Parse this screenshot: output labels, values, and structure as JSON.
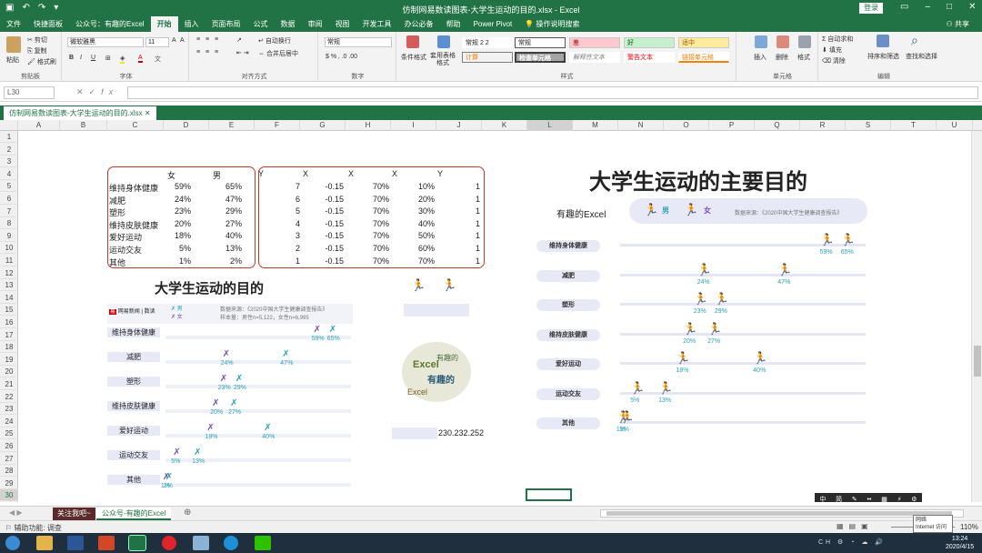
{
  "titlebar": {
    "title": "仿制网易数读图表-大学生运动的目的.xlsx  -  Excel",
    "login": "登录"
  },
  "menu": {
    "tabs": [
      "文件",
      "快捷面板",
      "公众号：有趣的Excel",
      "开始",
      "插入",
      "页面布局",
      "公式",
      "数据",
      "审阅",
      "视图",
      "开发工具",
      "办公必备",
      "帮助",
      "Power Pivot",
      "操作说明搜索"
    ],
    "active": "开始",
    "share": "共享"
  },
  "ribbon": {
    "clipboard": {
      "label": "剪贴板",
      "paste": "粘贴",
      "cut": "剪切",
      "copy": "复制",
      "painter": "格式刷"
    },
    "font": {
      "label": "字体",
      "name": "微软雅黑",
      "size": "11",
      "buttons": [
        "B",
        "I",
        "U"
      ]
    },
    "align": {
      "label": "对齐方式",
      "wrap": "自动换行",
      "merge": "合并后居中"
    },
    "number": {
      "label": "数字",
      "format": "常规"
    },
    "styles": {
      "label": "样式",
      "cond": "条件格式",
      "table": "套用表格格式",
      "s1": "常规 2 2",
      "s2": "常规",
      "s3": "差",
      "s4": "好",
      "s5": "适中",
      "s6": "计算",
      "s7": "检查单元格",
      "s8": "解释性文本",
      "s9": "警告文本",
      "s10": "链接单元格"
    },
    "cells": {
      "label": "单元格",
      "insert": "插入",
      "delete": "删除",
      "format": "格式"
    },
    "edit": {
      "label": "编辑",
      "autosum": "自动求和",
      "fill": "填充",
      "clear": "清除",
      "sort": "排序和筛选",
      "find": "查找和选择"
    }
  },
  "formula": {
    "cell": "L30",
    "fx": "fx"
  },
  "workbook_tab": "仿制网易数读图表-大学生运动的目的.xlsx",
  "columns": [
    "A",
    "B",
    "C",
    "D",
    "E",
    "F",
    "G",
    "H",
    "I",
    "J",
    "K",
    "L",
    "M",
    "N",
    "O",
    "P",
    "Q",
    "R",
    "S",
    "T",
    "U"
  ],
  "rows": [
    "1",
    "2",
    "3",
    "4",
    "5",
    "6",
    "7",
    "8",
    "9",
    "10",
    "11",
    "12",
    "13",
    "14",
    "15",
    "16",
    "17",
    "18",
    "19",
    "20",
    "21",
    "22",
    "23",
    "24",
    "25",
    "26",
    "27",
    "28",
    "29",
    "30"
  ],
  "table1": {
    "headers": [
      "女",
      "男"
    ],
    "rows": [
      [
        "维持身体健康",
        "59%",
        "65%"
      ],
      [
        "减肥",
        "24%",
        "47%"
      ],
      [
        "塑形",
        "23%",
        "29%"
      ],
      [
        "维持皮肤健康",
        "20%",
        "27%"
      ],
      [
        "爱好运动",
        "18%",
        "40%"
      ],
      [
        "运动交友",
        "5%",
        "13%"
      ],
      [
        "其他",
        "1%",
        "2%"
      ]
    ]
  },
  "table2": {
    "headers": [
      "Y",
      "X",
      "X",
      "X",
      "Y"
    ],
    "rows": [
      [
        "7",
        "-0.15",
        "70%",
        "10%",
        "1"
      ],
      [
        "6",
        "-0.15",
        "70%",
        "20%",
        "1"
      ],
      [
        "5",
        "-0.15",
        "70%",
        "30%",
        "1"
      ],
      [
        "4",
        "-0.15",
        "70%",
        "40%",
        "1"
      ],
      [
        "3",
        "-0.15",
        "70%",
        "50%",
        "1"
      ],
      [
        "2",
        "-0.15",
        "70%",
        "60%",
        "1"
      ],
      [
        "1",
        "-0.15",
        "70%",
        "70%",
        "1"
      ]
    ]
  },
  "left_chart": {
    "title": "大学生运动的目的",
    "brand": "网易新闻 | 数读",
    "legend_male": "男",
    "legend_female": "女",
    "source": "数据来源：《2020中国大学生健康调查报告》",
    "sample": "样本量：男性n=5,122，女性n=6,995",
    "categories": [
      "维持身体健康",
      "减肥",
      "塑形",
      "维持皮肤健康",
      "爱好运动",
      "运动交友",
      "其他"
    ],
    "female": [
      59,
      24,
      23,
      20,
      18,
      5,
      1
    ],
    "male": [
      65,
      47,
      29,
      27,
      40,
      13,
      2
    ],
    "female_labels": [
      "59%",
      "24%",
      "23%",
      "20%",
      "18%",
      "5%",
      "1%"
    ],
    "male_labels": [
      "65%",
      "47%",
      "29%",
      "27%",
      "40%",
      "13%",
      "2%"
    ]
  },
  "wordcloud": {
    "words": [
      "Excel",
      "有趣的",
      "Excel",
      "有趣的"
    ],
    "readout": "230.232.252"
  },
  "right_chart": {
    "title": "大学生运动的主要目的",
    "subtitle": "有趣的Excel",
    "legend_male": "男",
    "legend_female": "女",
    "source": "数据来源：《2020中国大学生健康调查报告》",
    "categories": [
      "维持身体健康",
      "减肥",
      "塑形",
      "维持皮肤健康",
      "爱好运动",
      "运动交友",
      "其他"
    ],
    "female_labels": [
      "59%",
      "24%",
      "23%",
      "20%",
      "18%",
      "5%",
      "1%"
    ],
    "male_labels": [
      "65%",
      "47%",
      "29%",
      "27%",
      "40%",
      "13%",
      "2%"
    ]
  },
  "floating_toolbar": [
    "中",
    "简",
    "✎",
    "••",
    "▦",
    "⚡",
    "⚙"
  ],
  "sheets": {
    "tab1": "关注我吧~",
    "tab2": "公众号-有趣的Excel"
  },
  "status": {
    "left": "辅助功能: 调查",
    "zoom": "110%"
  },
  "tooltip": {
    "line1": "网络",
    "line2": "Internet 访问"
  },
  "clock": {
    "time": "13:24",
    "date": "2020/4/15"
  },
  "colors": {
    "excel_green": "#217346",
    "female": "#7a4fb5",
    "male": "#2aa3b8",
    "table_border": "#c0392b"
  }
}
